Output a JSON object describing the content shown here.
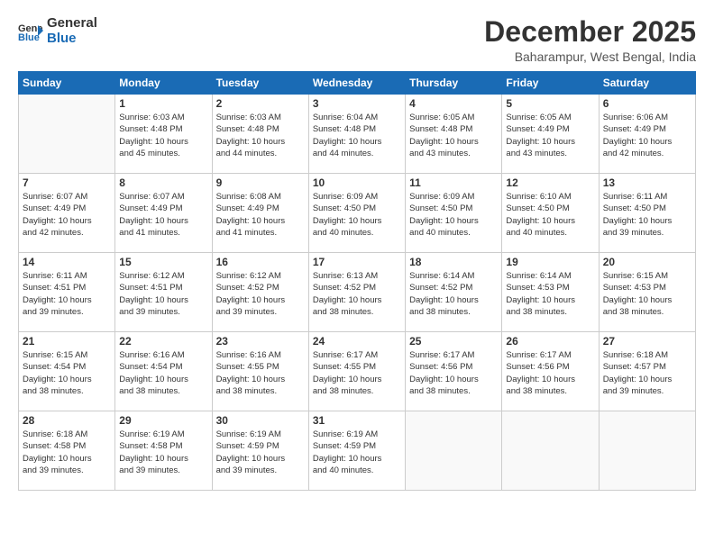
{
  "logo": {
    "line1": "General",
    "line2": "Blue"
  },
  "title": "December 2025",
  "location": "Baharampur, West Bengal, India",
  "weekdays": [
    "Sunday",
    "Monday",
    "Tuesday",
    "Wednesday",
    "Thursday",
    "Friday",
    "Saturday"
  ],
  "weeks": [
    [
      {
        "day": "",
        "info": ""
      },
      {
        "day": "1",
        "info": "Sunrise: 6:03 AM\nSunset: 4:48 PM\nDaylight: 10 hours\nand 45 minutes."
      },
      {
        "day": "2",
        "info": "Sunrise: 6:03 AM\nSunset: 4:48 PM\nDaylight: 10 hours\nand 44 minutes."
      },
      {
        "day": "3",
        "info": "Sunrise: 6:04 AM\nSunset: 4:48 PM\nDaylight: 10 hours\nand 44 minutes."
      },
      {
        "day": "4",
        "info": "Sunrise: 6:05 AM\nSunset: 4:48 PM\nDaylight: 10 hours\nand 43 minutes."
      },
      {
        "day": "5",
        "info": "Sunrise: 6:05 AM\nSunset: 4:49 PM\nDaylight: 10 hours\nand 43 minutes."
      },
      {
        "day": "6",
        "info": "Sunrise: 6:06 AM\nSunset: 4:49 PM\nDaylight: 10 hours\nand 42 minutes."
      }
    ],
    [
      {
        "day": "7",
        "info": "Sunrise: 6:07 AM\nSunset: 4:49 PM\nDaylight: 10 hours\nand 42 minutes."
      },
      {
        "day": "8",
        "info": "Sunrise: 6:07 AM\nSunset: 4:49 PM\nDaylight: 10 hours\nand 41 minutes."
      },
      {
        "day": "9",
        "info": "Sunrise: 6:08 AM\nSunset: 4:49 PM\nDaylight: 10 hours\nand 41 minutes."
      },
      {
        "day": "10",
        "info": "Sunrise: 6:09 AM\nSunset: 4:50 PM\nDaylight: 10 hours\nand 40 minutes."
      },
      {
        "day": "11",
        "info": "Sunrise: 6:09 AM\nSunset: 4:50 PM\nDaylight: 10 hours\nand 40 minutes."
      },
      {
        "day": "12",
        "info": "Sunrise: 6:10 AM\nSunset: 4:50 PM\nDaylight: 10 hours\nand 40 minutes."
      },
      {
        "day": "13",
        "info": "Sunrise: 6:11 AM\nSunset: 4:50 PM\nDaylight: 10 hours\nand 39 minutes."
      }
    ],
    [
      {
        "day": "14",
        "info": "Sunrise: 6:11 AM\nSunset: 4:51 PM\nDaylight: 10 hours\nand 39 minutes."
      },
      {
        "day": "15",
        "info": "Sunrise: 6:12 AM\nSunset: 4:51 PM\nDaylight: 10 hours\nand 39 minutes."
      },
      {
        "day": "16",
        "info": "Sunrise: 6:12 AM\nSunset: 4:52 PM\nDaylight: 10 hours\nand 39 minutes."
      },
      {
        "day": "17",
        "info": "Sunrise: 6:13 AM\nSunset: 4:52 PM\nDaylight: 10 hours\nand 38 minutes."
      },
      {
        "day": "18",
        "info": "Sunrise: 6:14 AM\nSunset: 4:52 PM\nDaylight: 10 hours\nand 38 minutes."
      },
      {
        "day": "19",
        "info": "Sunrise: 6:14 AM\nSunset: 4:53 PM\nDaylight: 10 hours\nand 38 minutes."
      },
      {
        "day": "20",
        "info": "Sunrise: 6:15 AM\nSunset: 4:53 PM\nDaylight: 10 hours\nand 38 minutes."
      }
    ],
    [
      {
        "day": "21",
        "info": "Sunrise: 6:15 AM\nSunset: 4:54 PM\nDaylight: 10 hours\nand 38 minutes."
      },
      {
        "day": "22",
        "info": "Sunrise: 6:16 AM\nSunset: 4:54 PM\nDaylight: 10 hours\nand 38 minutes."
      },
      {
        "day": "23",
        "info": "Sunrise: 6:16 AM\nSunset: 4:55 PM\nDaylight: 10 hours\nand 38 minutes."
      },
      {
        "day": "24",
        "info": "Sunrise: 6:17 AM\nSunset: 4:55 PM\nDaylight: 10 hours\nand 38 minutes."
      },
      {
        "day": "25",
        "info": "Sunrise: 6:17 AM\nSunset: 4:56 PM\nDaylight: 10 hours\nand 38 minutes."
      },
      {
        "day": "26",
        "info": "Sunrise: 6:17 AM\nSunset: 4:56 PM\nDaylight: 10 hours\nand 38 minutes."
      },
      {
        "day": "27",
        "info": "Sunrise: 6:18 AM\nSunset: 4:57 PM\nDaylight: 10 hours\nand 39 minutes."
      }
    ],
    [
      {
        "day": "28",
        "info": "Sunrise: 6:18 AM\nSunset: 4:58 PM\nDaylight: 10 hours\nand 39 minutes."
      },
      {
        "day": "29",
        "info": "Sunrise: 6:19 AM\nSunset: 4:58 PM\nDaylight: 10 hours\nand 39 minutes."
      },
      {
        "day": "30",
        "info": "Sunrise: 6:19 AM\nSunset: 4:59 PM\nDaylight: 10 hours\nand 39 minutes."
      },
      {
        "day": "31",
        "info": "Sunrise: 6:19 AM\nSunset: 4:59 PM\nDaylight: 10 hours\nand 40 minutes."
      },
      {
        "day": "",
        "info": ""
      },
      {
        "day": "",
        "info": ""
      },
      {
        "day": "",
        "info": ""
      }
    ]
  ]
}
